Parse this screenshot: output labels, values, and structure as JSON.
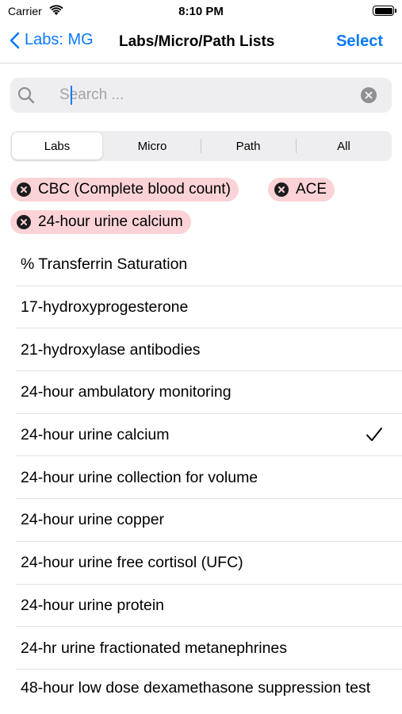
{
  "status_bar": {
    "carrier": "Carrier",
    "time": "8:10 PM",
    "battery_level": 1.0
  },
  "nav": {
    "back_label": "Labs: MG",
    "title": "Labs/Micro/Path Lists",
    "select_label": "Select",
    "accent_color": "#0a7aff"
  },
  "search": {
    "placeholder": "Search ...",
    "value": ""
  },
  "segments": [
    {
      "label": "Labs",
      "selected": true
    },
    {
      "label": "Micro",
      "selected": false
    },
    {
      "label": "Path",
      "selected": false
    },
    {
      "label": "All",
      "selected": false
    }
  ],
  "selected_chips": [
    {
      "label": "CBC (Complete blood count)"
    },
    {
      "label": "ACE"
    },
    {
      "label": "24-hour urine calcium"
    }
  ],
  "chip_color": "#fbd3d6",
  "list_items": [
    {
      "label": "% Transferrin Saturation",
      "checked": false
    },
    {
      "label": "17-hydroxyprogesterone",
      "checked": false
    },
    {
      "label": "21-hydroxylase antibodies",
      "checked": false
    },
    {
      "label": "24-hour ambulatory monitoring",
      "checked": false
    },
    {
      "label": "24-hour urine calcium",
      "checked": true
    },
    {
      "label": "24-hour urine collection for volume",
      "checked": false
    },
    {
      "label": "24-hour urine copper",
      "checked": false
    },
    {
      "label": "24-hour urine free cortisol (UFC)",
      "checked": false
    },
    {
      "label": "24-hour urine protein",
      "checked": false
    },
    {
      "label": "24-hr urine fractionated metanephrines",
      "checked": false
    },
    {
      "label": "48-hour low dose dexamethasone suppression test",
      "checked": false
    }
  ]
}
